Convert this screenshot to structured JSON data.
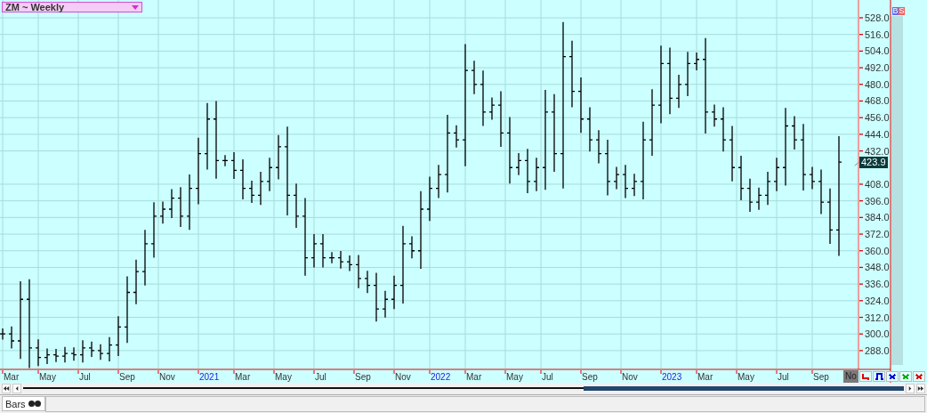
{
  "symbol_selector": {
    "label": "ZM ~ Weekly"
  },
  "side_buttons": [
    "B",
    "S"
  ],
  "chart": {
    "last_price": "423.9",
    "cursor_date": "No",
    "price_axis": [
      "528.0",
      "516.0",
      "504.0",
      "492.0",
      "480.0",
      "468.0",
      "456.0",
      "444.0",
      "432.0",
      "408.0",
      "396.0",
      "384.0",
      "372.0",
      "360.0",
      "348.0",
      "336.0",
      "324.0",
      "312.0",
      "300.0",
      "288.0"
    ],
    "date_axis": [
      {
        "label": "Mar",
        "kind": "month"
      },
      {
        "label": "May",
        "kind": "month"
      },
      {
        "label": "Jul",
        "kind": "month"
      },
      {
        "label": "Sep",
        "kind": "month"
      },
      {
        "label": "Nov",
        "kind": "month"
      },
      {
        "label": "2021",
        "kind": "year"
      },
      {
        "label": "Mar",
        "kind": "month"
      },
      {
        "label": "May",
        "kind": "month"
      },
      {
        "label": "Jul",
        "kind": "month"
      },
      {
        "label": "Sep",
        "kind": "month"
      },
      {
        "label": "Nov",
        "kind": "month"
      },
      {
        "label": "2022",
        "kind": "year"
      },
      {
        "label": "Mar",
        "kind": "month"
      },
      {
        "label": "May",
        "kind": "month"
      },
      {
        "label": "Jul",
        "kind": "month"
      },
      {
        "label": "Sep",
        "kind": "month"
      },
      {
        "label": "Nov",
        "kind": "month"
      },
      {
        "label": "2023",
        "kind": "year"
      },
      {
        "label": "Mar",
        "kind": "month"
      },
      {
        "label": "May",
        "kind": "month"
      },
      {
        "label": "Jul",
        "kind": "month"
      },
      {
        "label": "Sep",
        "kind": "month"
      }
    ]
  },
  "scroll_buttons": [
    {
      "kind": "first"
    },
    {
      "kind": "prev"
    },
    {
      "kind": "next"
    },
    {
      "kind": "last"
    }
  ],
  "tool_buttons": [
    {
      "kind": "step",
      "color": "#e00000"
    },
    {
      "kind": "pulse",
      "color": "#0000e0"
    },
    {
      "kind": "cross",
      "color": "#0000e0"
    },
    {
      "kind": "cross",
      "color": "#00b000"
    },
    {
      "kind": "cross",
      "color": "#e00000"
    }
  ],
  "tabs": [
    {
      "label": "Bars",
      "selected": true
    }
  ]
}
